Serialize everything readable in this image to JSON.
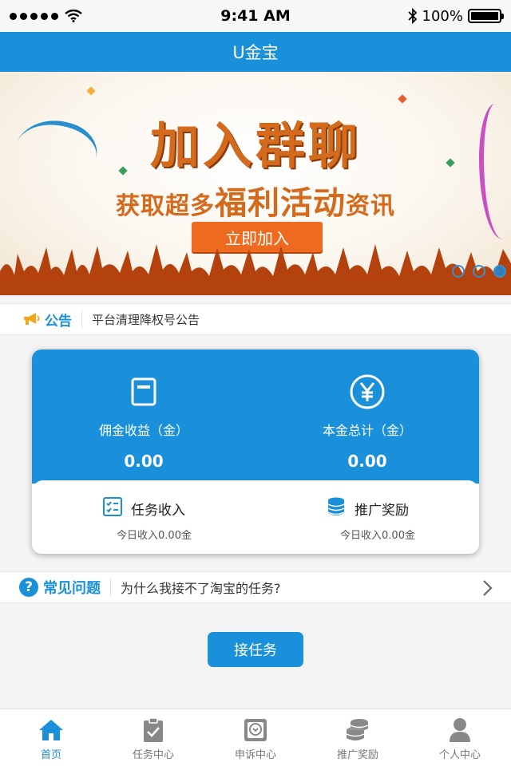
{
  "status_bar": {
    "time": "9:41 AM",
    "battery": "100%",
    "signal_bars": 5
  },
  "header": {
    "title": "U金宝"
  },
  "banner": {
    "title": "加入群聊",
    "subtitle_start": "获取超多",
    "subtitle_highlight": "福利活动",
    "subtitle_end": "资讯",
    "button_label": "立即加入",
    "slide_count": 3,
    "active_slide": 3
  },
  "notice": {
    "label": "公告",
    "text": "平台清理降权号公告"
  },
  "assets": {
    "commission": {
      "label": "佣金收益（金）",
      "value": "0.00"
    },
    "principal": {
      "label": "本金总计（金）",
      "value": "0.00"
    },
    "task_income": {
      "label": "任务收入",
      "sub": "今日收入0.00金"
    },
    "promo_reward": {
      "label": "推广奖励",
      "sub": "今日收入0.00金"
    }
  },
  "faq": {
    "label": "常见问题",
    "text": "为什么我接不了淘宝的任务?"
  },
  "action": {
    "label": "接任务"
  },
  "tabs": [
    {
      "label": "首页",
      "icon": "home-icon",
      "active": true
    },
    {
      "label": "任务中心",
      "icon": "clipboard-check-icon",
      "active": false
    },
    {
      "label": "申诉中心",
      "icon": "inbox-icon",
      "active": false
    },
    {
      "label": "推广奖励",
      "icon": "coins-icon",
      "active": false
    },
    {
      "label": "个人中心",
      "icon": "user-icon",
      "active": false
    }
  ],
  "colors": {
    "primary": "#1a90db",
    "banner_orange": "#ed6a1f",
    "text_dark": "#333333"
  }
}
